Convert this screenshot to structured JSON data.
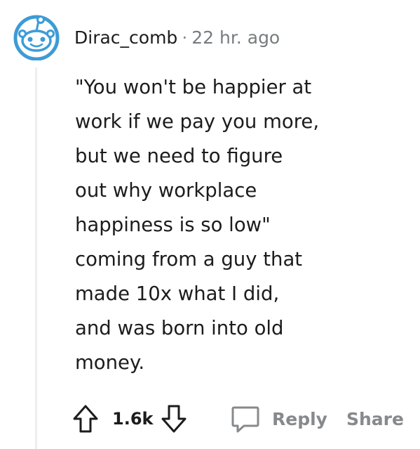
{
  "comment": {
    "avatar_icon": "snoo-avatar-icon",
    "author": "Dirac_comb",
    "separator": "·",
    "time": "22 hr. ago",
    "body_lines": [
      "\"You won't be happier at",
      "work if we pay you more,",
      "but we need to figure",
      "out why workplace",
      "happiness is so low\"",
      "coming from a guy that",
      "made 10x what I did,",
      "and was born into old",
      "money."
    ]
  },
  "actions": {
    "upvote_icon": "upvote-arrow-icon",
    "score": "1.6k",
    "downvote_icon": "downvote-arrow-icon",
    "reply_icon": "speech-bubble-icon",
    "reply_label": "Reply",
    "share_label": "Share"
  },
  "colors": {
    "avatar_blue": "#3d9bd6",
    "meta_gray": "#787c7e",
    "action_gray": "#878a8c",
    "thread_line": "#edeff1"
  }
}
